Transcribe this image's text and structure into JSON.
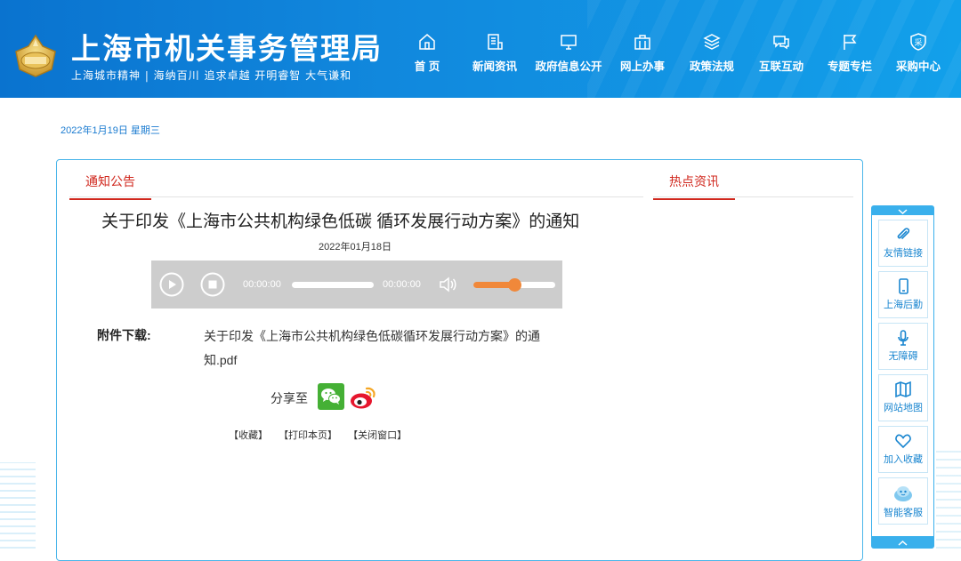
{
  "header": {
    "title": "上海市机关事务管理局",
    "slogan": "上海城市精神 | 海纳百川  追求卓越    开明睿智  大气谦和",
    "nav": [
      {
        "label": "首 页",
        "icon": "home-icon"
      },
      {
        "label": "新闻资讯",
        "icon": "news-icon"
      },
      {
        "label": "政府信息公开",
        "icon": "monitor-icon"
      },
      {
        "label": "网上办事",
        "icon": "briefcase-icon"
      },
      {
        "label": "政策法规",
        "icon": "stack-icon"
      },
      {
        "label": "互联互动",
        "icon": "chat-icon"
      },
      {
        "label": "专题专栏",
        "icon": "flag-icon"
      },
      {
        "label": "采购中心",
        "icon": "shield-icon",
        "glyph": "采"
      }
    ]
  },
  "date_line": "2022年1月19日 星期三",
  "tabs": {
    "notice": "通知公告",
    "hot": "热点资讯"
  },
  "article": {
    "title": "关于印发《上海市公共机构绿色低碳 循环发展行动方案》的通知",
    "date": "2022年01月18日",
    "audio": {
      "current_time": "00:00:00",
      "total_time": "00:00:00",
      "progress": 0,
      "volume": 0.5
    },
    "attachment_label": "附件下载:",
    "attachment_link": "关于印发《上海市公共机构绿色低碳循环发展行动方案》的通知.pdf",
    "share_label": "分享至",
    "actions": {
      "favorite": "【收藏】",
      "print": "【打印本页】",
      "close": "【关闭窗口】"
    }
  },
  "sidebar": {
    "items": [
      {
        "label": "友情链接",
        "icon": "paperclip-icon"
      },
      {
        "label": "上海后勤",
        "icon": "phone-icon"
      },
      {
        "label": "无障碍",
        "icon": "microphone-icon"
      },
      {
        "label": "网站地图",
        "icon": "map-icon"
      },
      {
        "label": "加入收藏",
        "icon": "heart-icon"
      },
      {
        "label": "智能客服",
        "icon": "robot-icon"
      }
    ]
  },
  "colors": {
    "header_blue": "#1188dd",
    "accent_red": "#d0271d",
    "sidebar_blue": "#3ab0ec",
    "volume_orange": "#f0883a",
    "wechat_green": "#45b035",
    "weibo_red": "#e6162d"
  }
}
